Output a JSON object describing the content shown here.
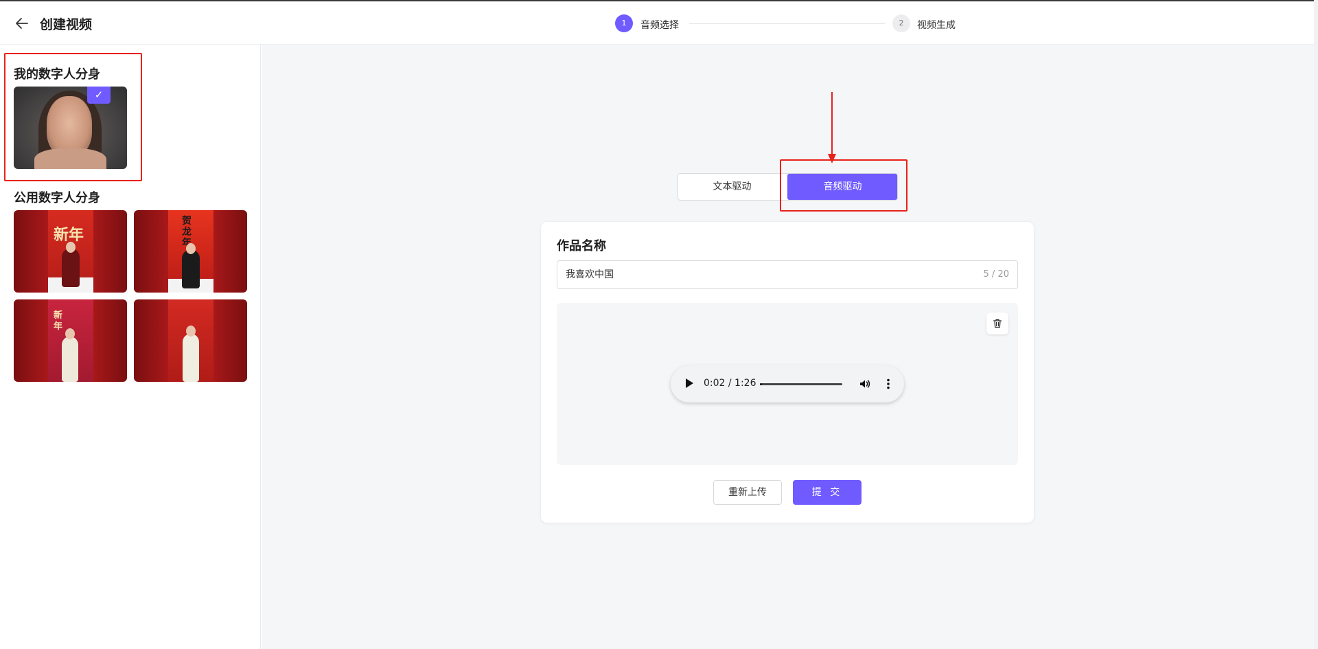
{
  "header": {
    "title": "创建视频",
    "steps": [
      {
        "num": "1",
        "label": "音频选择"
      },
      {
        "num": "2",
        "label": "视频生成"
      }
    ]
  },
  "sidebar": {
    "my_title": "我的数字人分身",
    "public_title": "公用数字人分身",
    "check_mark": "✓",
    "public_items": [
      {
        "deco": "新年"
      },
      {
        "deco": "贺龙年"
      },
      {
        "deco": "新年"
      },
      {
        "deco": ""
      }
    ]
  },
  "mode": {
    "text_label": "文本驱动",
    "audio_label": "音频驱动"
  },
  "card": {
    "title": "作品名称",
    "name_value": "我喜欢中国",
    "name_count": "5 / 20",
    "player_time": "0:02 / 1:26",
    "player_progress": 0.023,
    "reupload_label": "重新上传",
    "submit_label": "提 交"
  },
  "colors": {
    "accent": "#6f5bff",
    "annotation": "#e8211a"
  }
}
